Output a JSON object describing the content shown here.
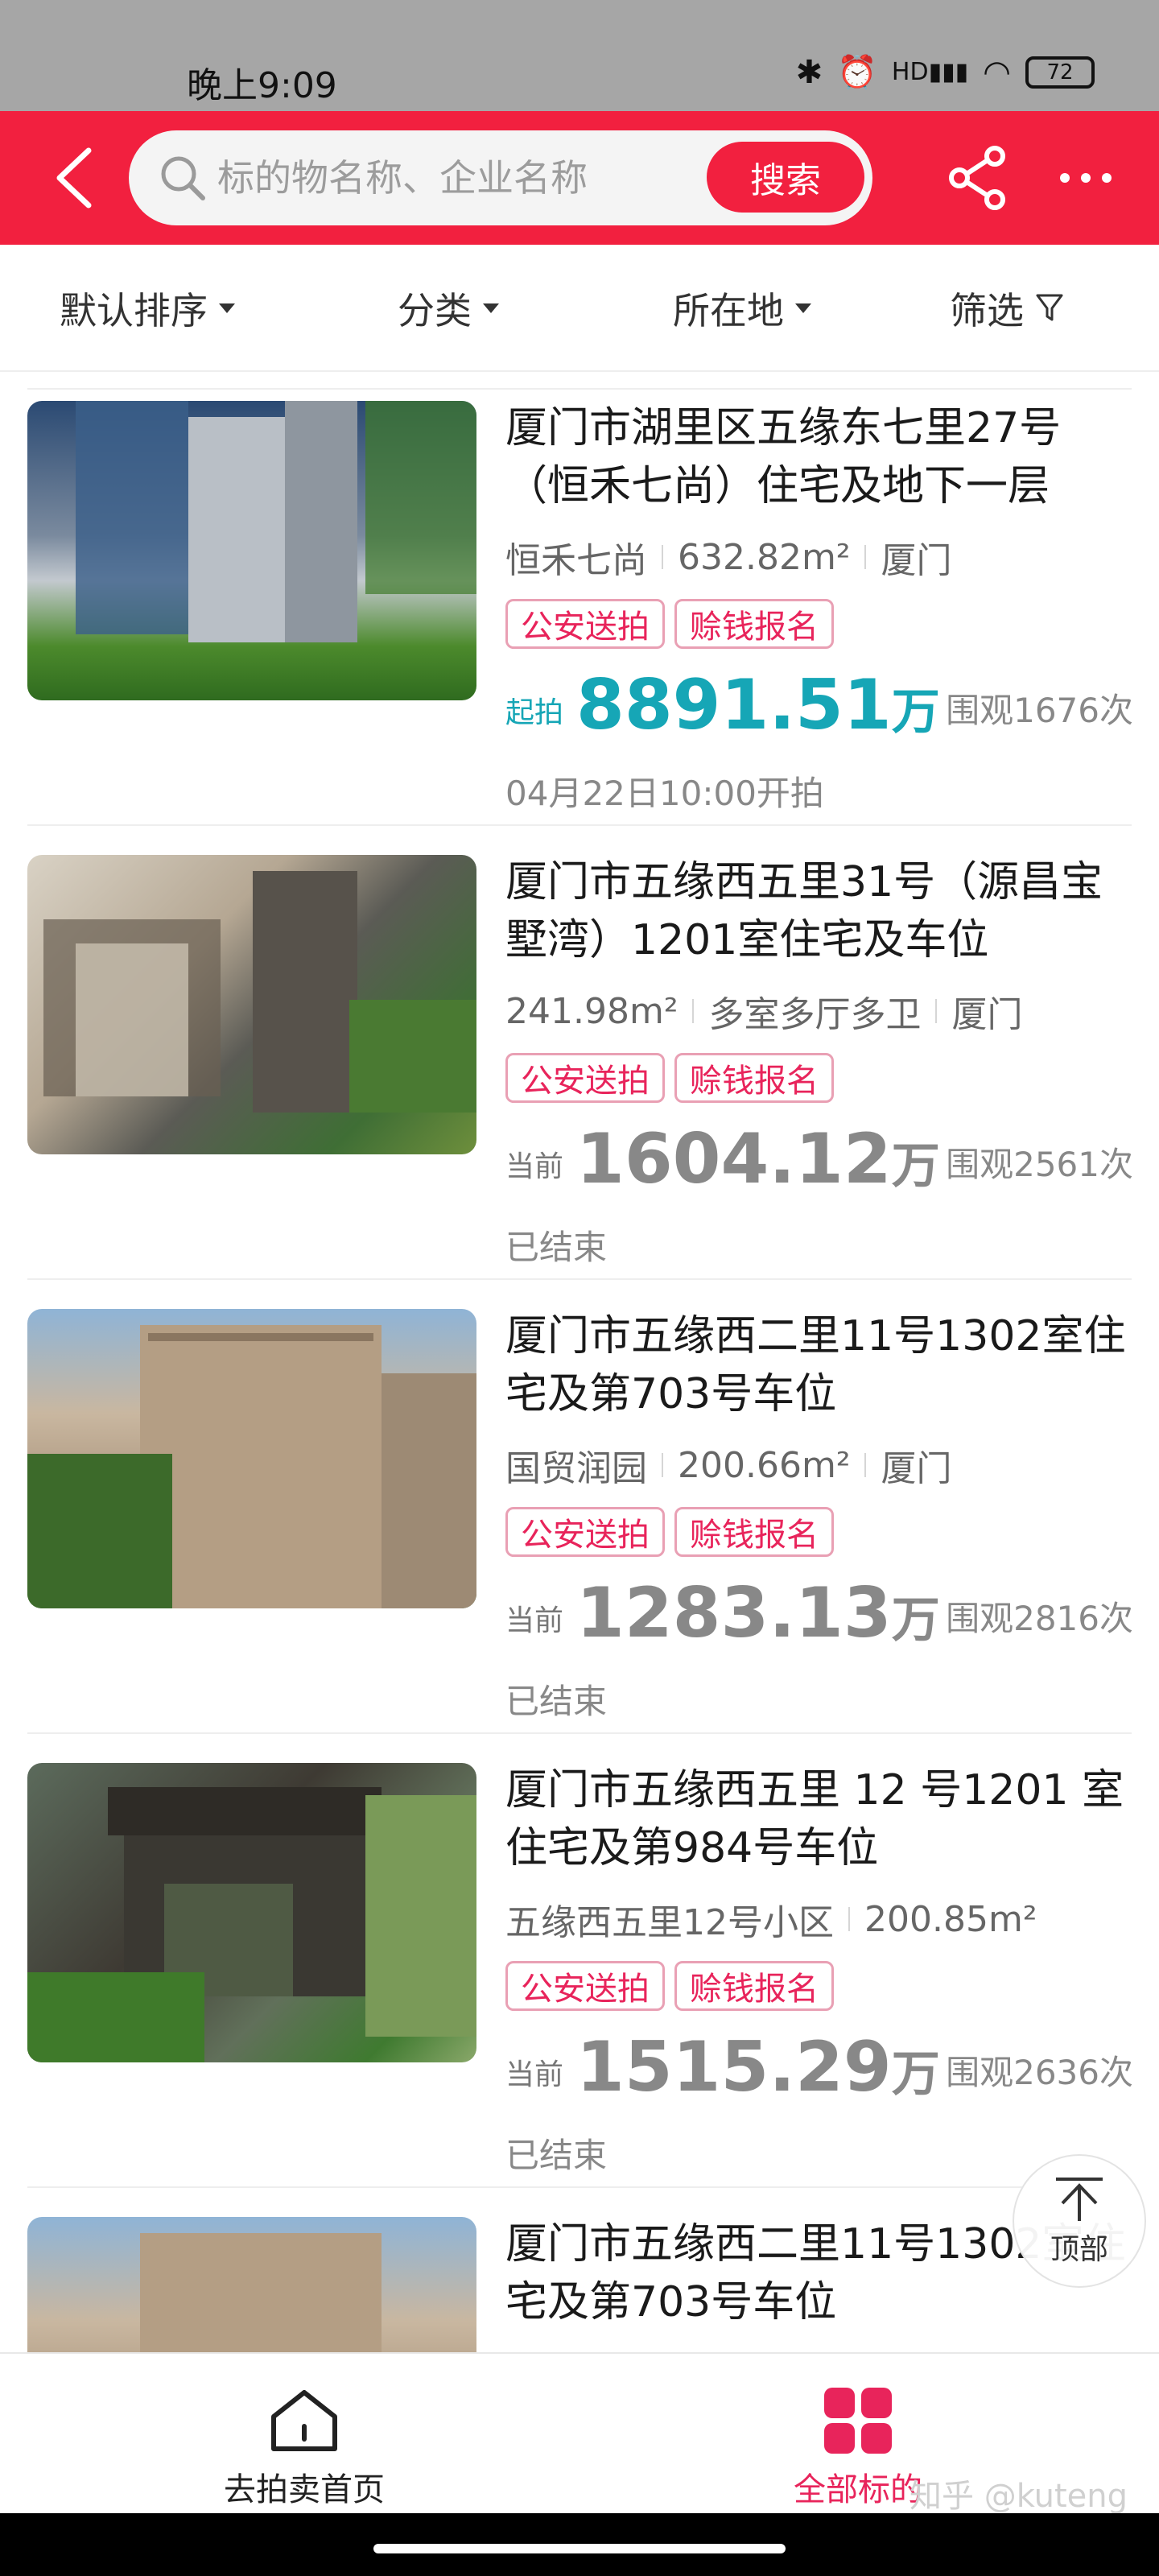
{
  "status_bar": {
    "time": "晚上9:09",
    "battery": "72",
    "icons": [
      "bluetooth-icon",
      "alarm-icon",
      "hd-signal-icon",
      "wifi-icon",
      "battery-icon"
    ]
  },
  "header": {
    "search_placeholder": "标的物名称、企业名称",
    "search_button": "搜索",
    "accent": "#f2203f"
  },
  "filters": {
    "sort": "默认排序",
    "category": "分类",
    "location": "所在地",
    "screen": "筛选"
  },
  "items": [
    {
      "title": "厦门市湖里区五缘东七里27号（恒禾七尚）住宅及地下一层",
      "meta": [
        "恒禾七尚",
        "632.82m²",
        "厦门"
      ],
      "tags": [
        "公安送拍",
        "赊钱报名"
      ],
      "price_prefix": "起拍",
      "price": "8891.51",
      "price_unit": "万",
      "views": "围观1676次",
      "status": "04月22日10:00开拍"
    },
    {
      "title": "厦门市五缘西五里31号（源昌宝墅湾）1201室住宅及车位",
      "meta": [
        "241.98m²",
        "多室多厅多卫",
        "厦门"
      ],
      "tags": [
        "公安送拍",
        "赊钱报名"
      ],
      "price_prefix": "当前",
      "price": "1604.12",
      "price_unit": "万",
      "views": "围观2561次",
      "status": "已结束"
    },
    {
      "title": "厦门市五缘西二里11号1302室住宅及第703号车位",
      "meta": [
        "国贸润园",
        "200.66m²",
        "厦门"
      ],
      "tags": [
        "公安送拍",
        "赊钱报名"
      ],
      "price_prefix": "当前",
      "price": "1283.13",
      "price_unit": "万",
      "views": "围观2816次",
      "status": "已结束"
    },
    {
      "title": "厦门市五缘西五里 12 号1201 室住宅及第984号车位",
      "meta": [
        "五缘西五里12号小区",
        "200.85m²"
      ],
      "tags": [
        "公安送拍",
        "赊钱报名"
      ],
      "price_prefix": "当前",
      "price": "1515.29",
      "price_unit": "万",
      "views": "围观2636次",
      "status": "已结束"
    },
    {
      "title": "厦门市五缘西二里11号1302室住宅及第703号车位"
    }
  ],
  "top_button": "顶部",
  "bottom_nav": {
    "home": "去拍卖首页",
    "all": "全部标的",
    "active_color": "#e8245b"
  },
  "watermark": "知乎 @kuteng"
}
